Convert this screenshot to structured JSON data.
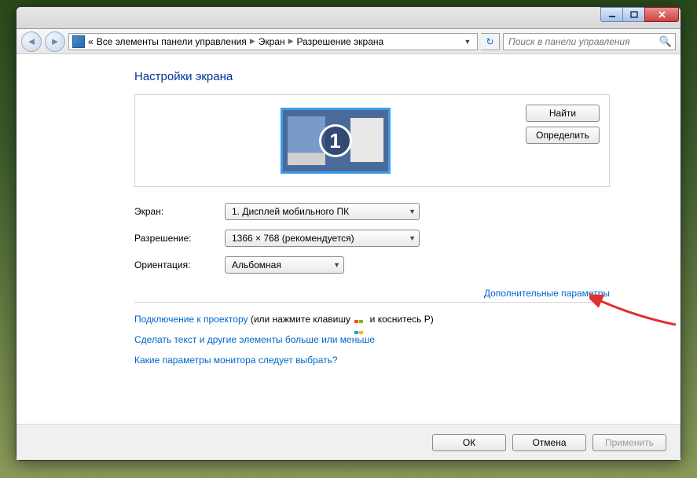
{
  "breadcrumb": {
    "prefix": "«",
    "parts": [
      "Все элементы панели управления",
      "Экран",
      "Разрешение экрана"
    ]
  },
  "search": {
    "placeholder": "Поиск в панели управления"
  },
  "heading": "Настройки экрана",
  "monitor_number": "1",
  "buttons": {
    "find": "Найти",
    "identify": "Определить",
    "ok": "ОК",
    "cancel": "Отмена",
    "apply": "Применить"
  },
  "labels": {
    "screen": "Экран:",
    "resolution": "Разрешение:",
    "orientation": "Ориентация:"
  },
  "values": {
    "screen": "1. Дисплей мобильного ПК",
    "resolution": "1366 × 768 (рекомендуется)",
    "orientation": "Альбомная"
  },
  "links": {
    "advanced": "Дополнительные параметры",
    "projector_pre": "Подключение к проектору",
    "projector_post": " (или нажмите клавишу ",
    "projector_tail": " и коснитесь P)",
    "text_size": "Сделать текст и другие элементы больше или меньше",
    "which_monitor": "Какие параметры монитора следует выбрать?"
  }
}
